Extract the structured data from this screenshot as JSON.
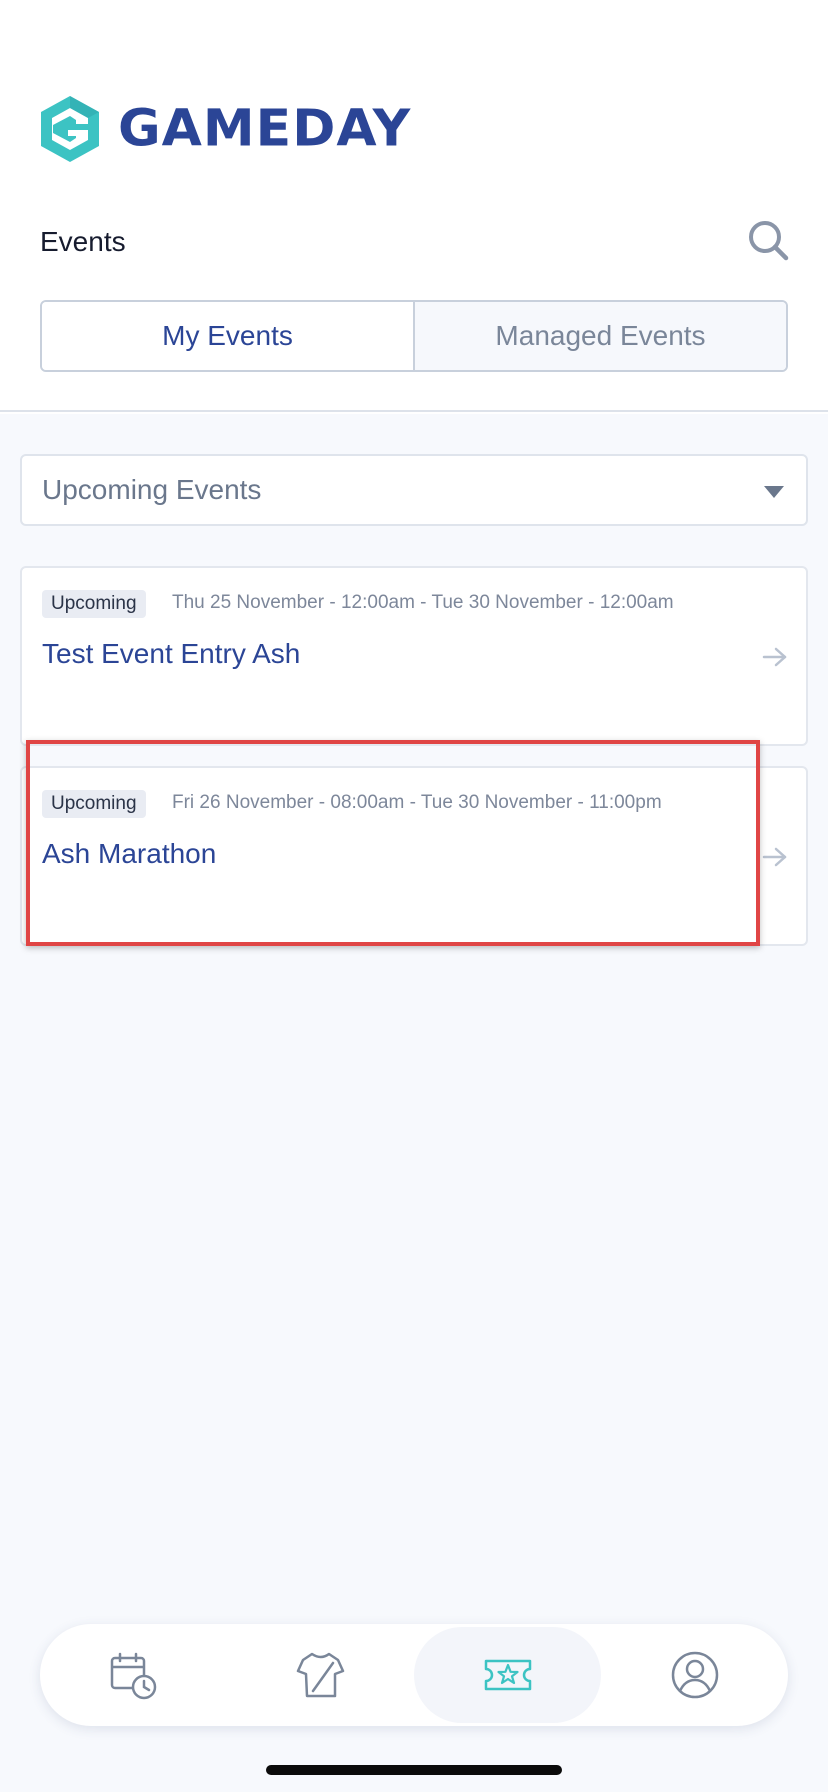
{
  "brand": {
    "name": "GAMEDAY",
    "primary_color": "#2b4596",
    "accent_color": "#3cc3c3"
  },
  "header": {
    "title": "Events",
    "search_icon": "search-icon",
    "tabs": [
      {
        "label": "My Events",
        "active": true
      },
      {
        "label": "Managed Events",
        "active": false
      }
    ]
  },
  "filter": {
    "selected": "Upcoming Events"
  },
  "events": [
    {
      "status": "Upcoming",
      "dates": "Thu 25 November - 12:00am - Tue 30 November - 12:00am",
      "name": "Test Event Entry Ash"
    },
    {
      "status": "Upcoming",
      "dates": "Fri 26 November - 08:00am - Tue 30 November - 11:00pm",
      "name": "Ash Marathon"
    }
  ],
  "highlight_color": "#e04545",
  "bottom_nav": [
    {
      "icon": "calendar-clock-icon",
      "active": false
    },
    {
      "icon": "jersey-edit-icon",
      "active": false
    },
    {
      "icon": "ticket-star-icon",
      "active": true
    },
    {
      "icon": "user-circle-icon",
      "active": false
    }
  ]
}
